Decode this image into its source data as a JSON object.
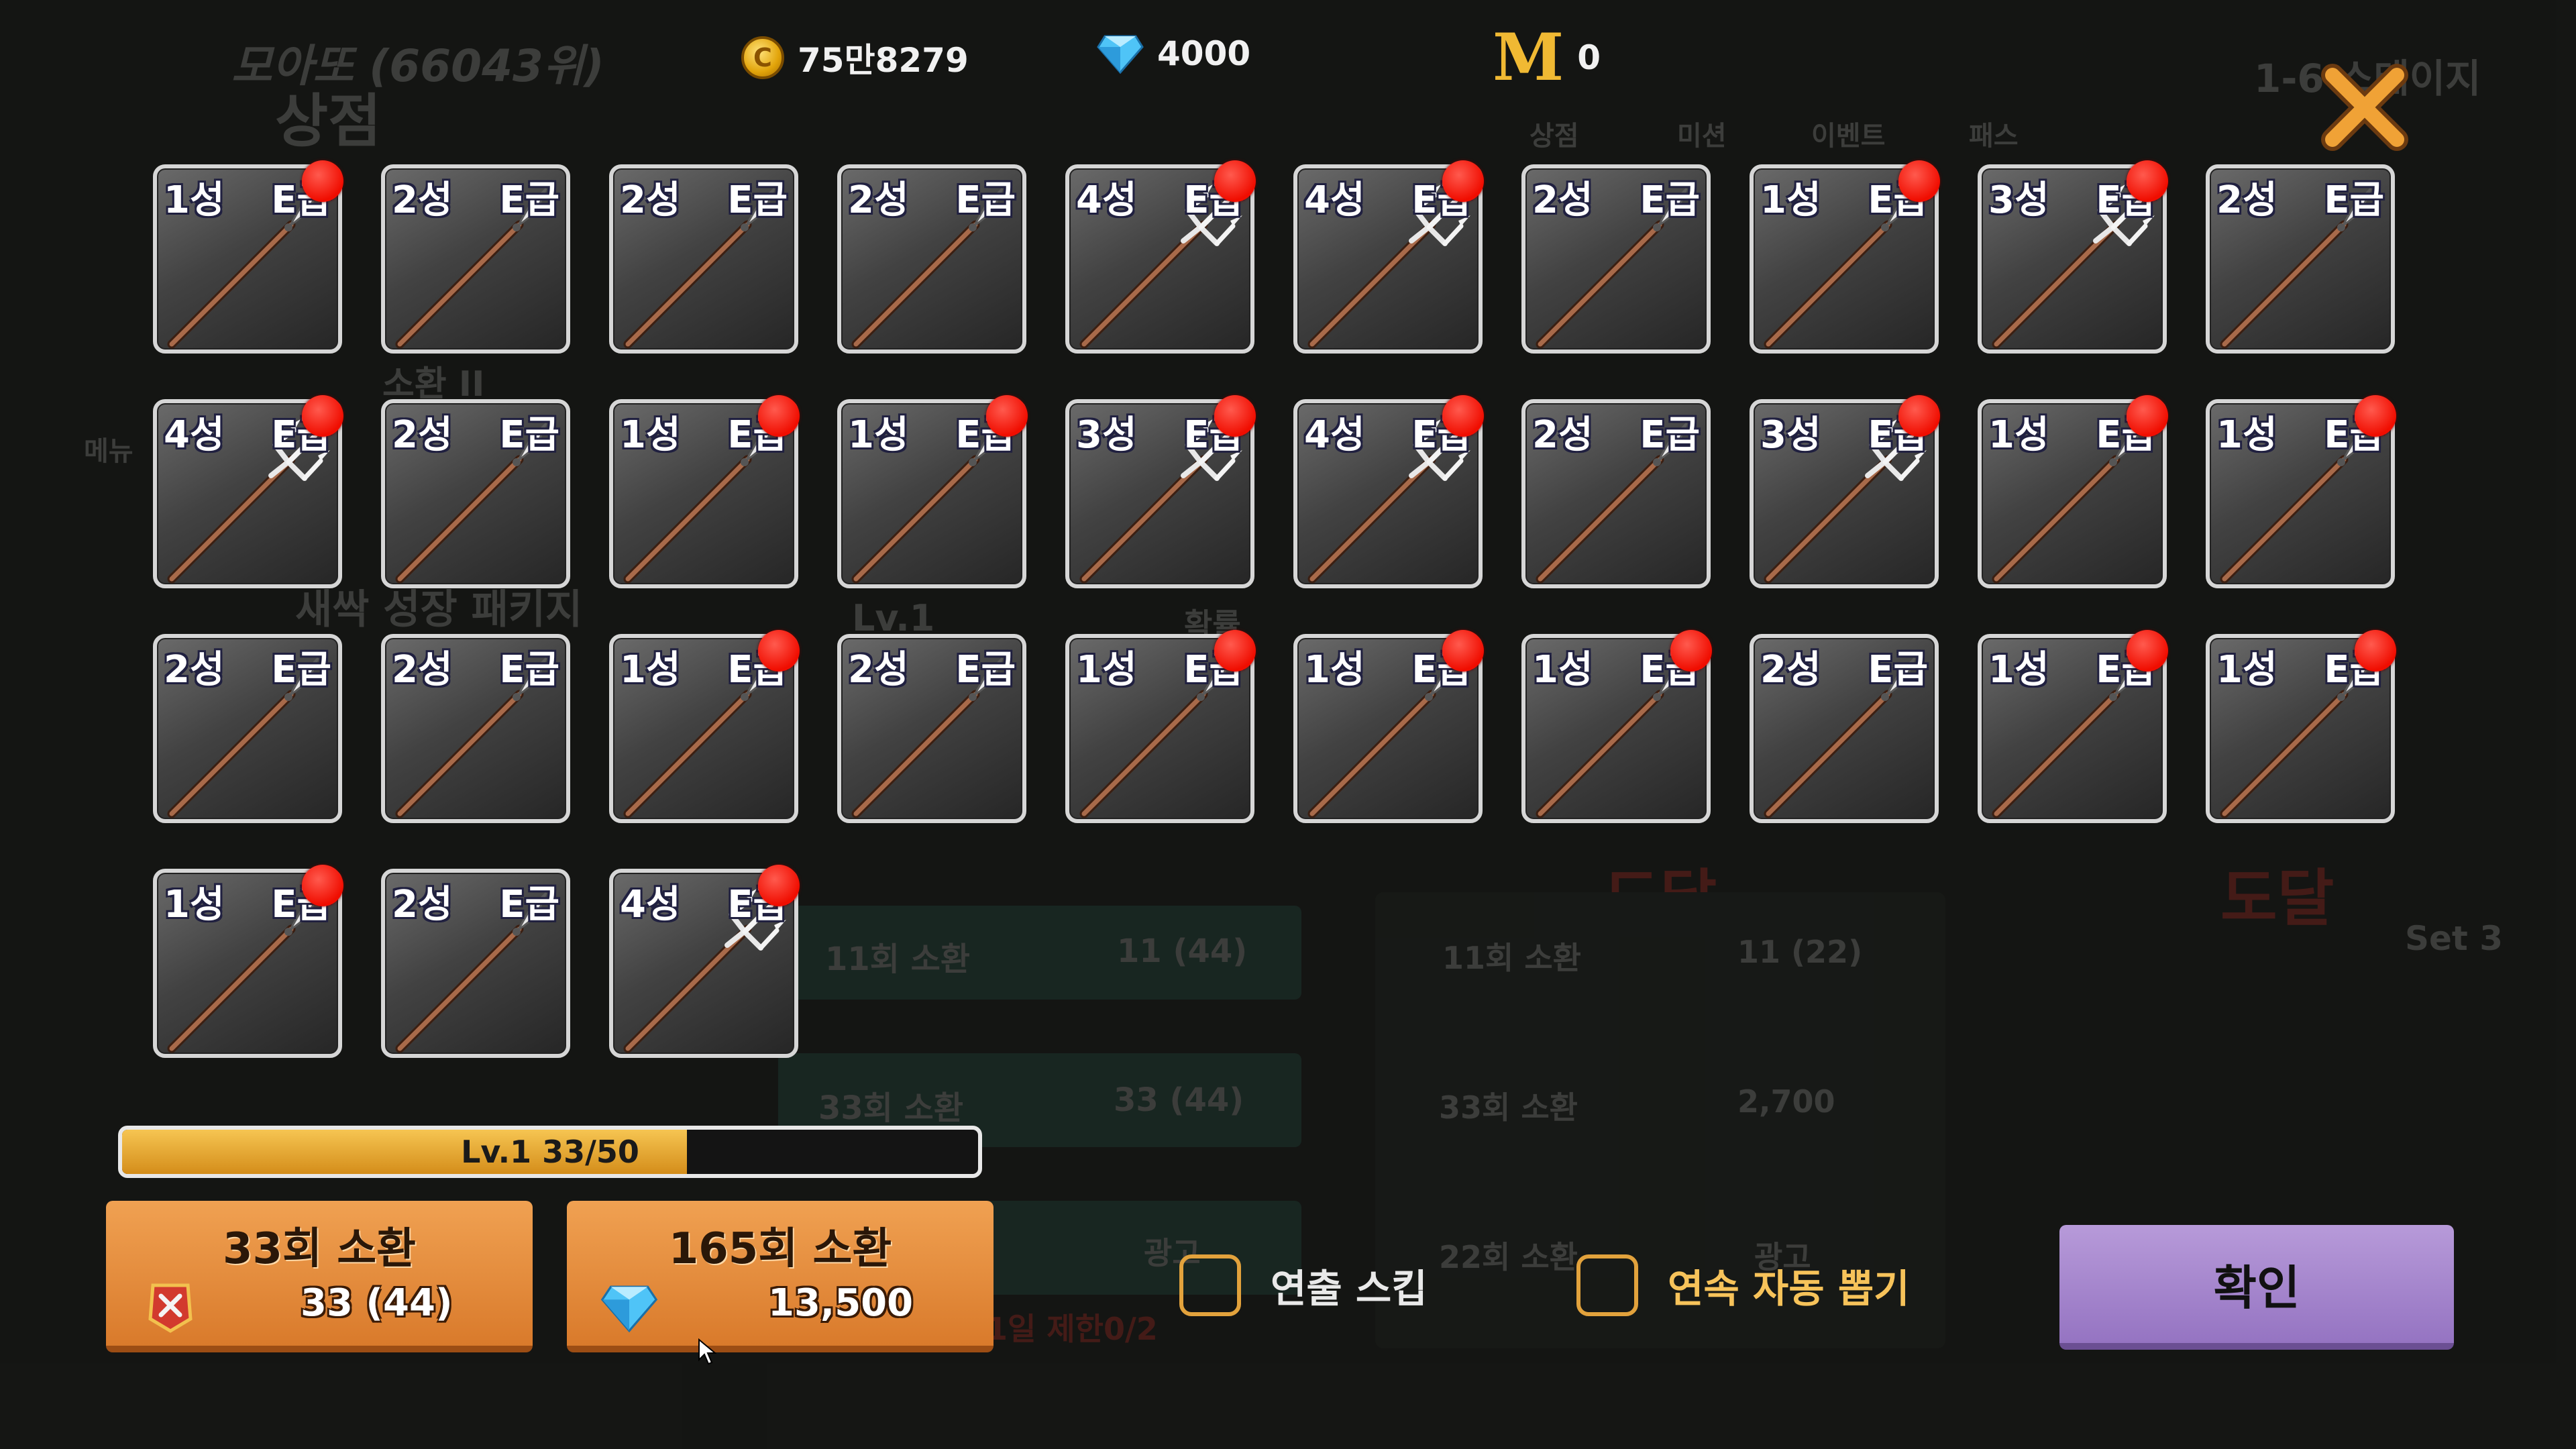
{
  "background": {
    "player_name": "모아또 (66043위)",
    "shop_title": "상점",
    "tabs": [
      "상점",
      "미션",
      "이벤트",
      "패스"
    ],
    "stage_label": "1-6 스테이지",
    "rows": [
      {
        "label": "11회 소환",
        "cost": "11 (44)"
      },
      {
        "label": "33회 소환",
        "cost": "33 (44)"
      }
    ],
    "mid_rows": [
      {
        "label": "11회 소환",
        "cost": "11 (22)"
      },
      {
        "label": "33회 소환",
        "cost": "2,700"
      },
      {
        "label": "22회 소환",
        "cost": "광고"
      }
    ],
    "reach_label": "도달",
    "ad_label": "광고",
    "daily_limit": "1일 제한0/2",
    "level_label": "Lv.1",
    "rate_label": "확률",
    "set_label": "Set 3",
    "package_label": "새싹 성장 패키지",
    "summon_label": "소환 II",
    "menu_label": "메뉴"
  },
  "top_bar": {
    "gold": "75만8279",
    "gems": "4000",
    "mileage_icon": "M",
    "mileage": "0",
    "close_icon": "close-x-icon"
  },
  "items": [
    {
      "star": "1성",
      "grade": "E급",
      "weapon": "spear",
      "new": true
    },
    {
      "star": "2성",
      "grade": "E급",
      "weapon": "spear",
      "new": false
    },
    {
      "star": "2성",
      "grade": "E급",
      "weapon": "spear",
      "new": false
    },
    {
      "star": "2성",
      "grade": "E급",
      "weapon": "spear",
      "new": false
    },
    {
      "star": "4성",
      "grade": "E급",
      "weapon": "trident",
      "new": true
    },
    {
      "star": "4성",
      "grade": "E급",
      "weapon": "trident",
      "new": true
    },
    {
      "star": "2성",
      "grade": "E급",
      "weapon": "spear",
      "new": false
    },
    {
      "star": "1성",
      "grade": "E급",
      "weapon": "spear",
      "new": true
    },
    {
      "star": "3성",
      "grade": "E급",
      "weapon": "trident",
      "new": true
    },
    {
      "star": "2성",
      "grade": "E급",
      "weapon": "spear",
      "new": false
    },
    {
      "star": "4성",
      "grade": "E급",
      "weapon": "trident",
      "new": true
    },
    {
      "star": "2성",
      "grade": "E급",
      "weapon": "spear",
      "new": false
    },
    {
      "star": "1성",
      "grade": "E급",
      "weapon": "spear",
      "new": true
    },
    {
      "star": "1성",
      "grade": "E급",
      "weapon": "spear",
      "new": true
    },
    {
      "star": "3성",
      "grade": "E급",
      "weapon": "trident",
      "new": true
    },
    {
      "star": "4성",
      "grade": "E급",
      "weapon": "trident",
      "new": true
    },
    {
      "star": "2성",
      "grade": "E급",
      "weapon": "spear",
      "new": false
    },
    {
      "star": "3성",
      "grade": "E급",
      "weapon": "trident",
      "new": true
    },
    {
      "star": "1성",
      "grade": "E급",
      "weapon": "spear",
      "new": true
    },
    {
      "star": "1성",
      "grade": "E급",
      "weapon": "spear",
      "new": true
    },
    {
      "star": "2성",
      "grade": "E급",
      "weapon": "spear",
      "new": false
    },
    {
      "star": "2성",
      "grade": "E급",
      "weapon": "spear",
      "new": false
    },
    {
      "star": "1성",
      "grade": "E급",
      "weapon": "spear",
      "new": true
    },
    {
      "star": "2성",
      "grade": "E급",
      "weapon": "spear",
      "new": false
    },
    {
      "star": "1성",
      "grade": "E급",
      "weapon": "spear",
      "new": true
    },
    {
      "star": "1성",
      "grade": "E급",
      "weapon": "spear",
      "new": true
    },
    {
      "star": "1성",
      "grade": "E급",
      "weapon": "spear",
      "new": true
    },
    {
      "star": "2성",
      "grade": "E급",
      "weapon": "spear",
      "new": false
    },
    {
      "star": "1성",
      "grade": "E급",
      "weapon": "spear",
      "new": true
    },
    {
      "star": "1성",
      "grade": "E급",
      "weapon": "spear",
      "new": true
    },
    {
      "star": "1성",
      "grade": "E급",
      "weapon": "spear",
      "new": true
    },
    {
      "star": "2성",
      "grade": "E급",
      "weapon": "spear",
      "new": false
    },
    {
      "star": "4성",
      "grade": "E급",
      "weapon": "trident",
      "new": true
    }
  ],
  "progress": {
    "label": "Lv.1 33/50",
    "fraction": 0.66
  },
  "summon_buttons": [
    {
      "title": "33회 소환",
      "cost": "33 (44)",
      "icon": "ticket-icon"
    },
    {
      "title": "165회 소환",
      "cost": "13,500",
      "icon": "diamond-icon"
    }
  ],
  "options": {
    "skip_label": "연출 스킵",
    "auto_label": "연속 자동 뽑기"
  },
  "confirm_label": "확인",
  "colors": {
    "accent_orange": "#e08a38",
    "confirm_purple": "#a887cf",
    "new_dot": "#f00d00",
    "auto_text": "#f7c35a"
  }
}
